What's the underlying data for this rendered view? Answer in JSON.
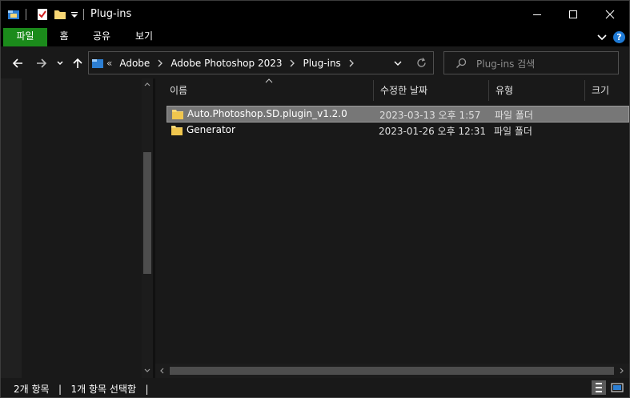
{
  "window": {
    "title": "Plug-ins",
    "controls": {
      "minimize": "—",
      "maximize": "☐",
      "close": "✕"
    }
  },
  "ribbon": {
    "tabs": [
      {
        "label": "파일",
        "active": true
      },
      {
        "label": "홈"
      },
      {
        "label": "공유"
      },
      {
        "label": "보기"
      }
    ],
    "help_label": "?"
  },
  "address": {
    "overflow": "«",
    "crumbs": [
      "Adobe",
      "Adobe Photoshop 2023",
      "Plug-ins"
    ]
  },
  "search": {
    "placeholder": "Plug-ins 검색"
  },
  "columns": [
    "이름",
    "수정한 날짜",
    "유형",
    "크기"
  ],
  "files": [
    {
      "name": "Auto.Photoshop.SD.plugin_v1.2.0",
      "modified": "2023-03-13 오후 1:57",
      "type": "파일 폴더",
      "selected": true
    },
    {
      "name": "Generator",
      "modified": "2023-01-26 오후 12:31",
      "type": "파일 폴더",
      "selected": false
    }
  ],
  "status": {
    "items": "2개 항목",
    "selected": "1개 항목 선택함",
    "sep": "|"
  },
  "colors": {
    "accent_file_tab": "#1b8b1b",
    "background": "#191919",
    "selection": "#777777",
    "folder": "#f8d775",
    "help": "#1e7ad6"
  }
}
